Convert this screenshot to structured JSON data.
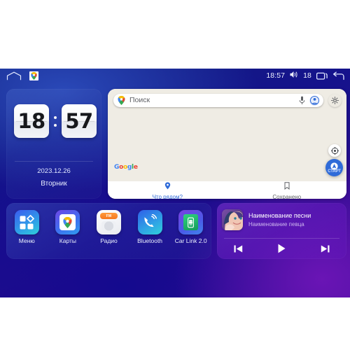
{
  "statusbar": {
    "home_icon": "home-outline-icon",
    "maps_icon": "google-maps-icon",
    "time": "18:57",
    "volume_icon": "volume-icon",
    "volume_level": "18",
    "recents_icon": "recents-square-icon",
    "back_icon": "back-arrow-icon"
  },
  "clock_widget": {
    "hours": "18",
    "minutes": "57",
    "date": "2023.12.26",
    "weekday": "Вторник"
  },
  "map_widget": {
    "search": {
      "placeholder": "Поиск",
      "pin_icon": "google-maps-pin-icon",
      "mic_icon": "microphone-icon",
      "avatar_icon": "account-avatar-icon"
    },
    "settings_icon": "gear-icon",
    "compass_icon": "compass-icon",
    "start_button_label": "СТАРТ",
    "start_button_icon": "navigation-arrow-icon",
    "brand": "Google",
    "tabs": [
      {
        "label": "Что рядом?",
        "icon": "location-pin-icon",
        "active": true
      },
      {
        "label": "Сохранено",
        "icon": "bookmark-icon",
        "active": false
      }
    ]
  },
  "apps": [
    {
      "label": "Меню",
      "icon": "grid-menu-icon"
    },
    {
      "label": "Карты",
      "icon": "google-maps-icon"
    },
    {
      "label": "Радио",
      "icon": "radio-icon",
      "badge": "FM"
    },
    {
      "label": "Bluetooth",
      "icon": "bluetooth-call-icon"
    },
    {
      "label": "Car Link 2.0",
      "icon": "car-link-icon"
    }
  ],
  "music_widget": {
    "album_art": "album-art-portrait",
    "title": "Наименование песни",
    "artist": "Наименование певца",
    "controls": [
      {
        "name": "previous",
        "icon": "skip-previous-icon"
      },
      {
        "name": "play",
        "icon": "play-icon"
      },
      {
        "name": "next",
        "icon": "skip-next-icon"
      }
    ]
  },
  "colors": {
    "accent_blue": "#2f6bd8",
    "bg_deep_blue": "#15128c",
    "bg_purple": "#4e0c9e",
    "map_surface": "#efece4",
    "radio_orange": "#f5781f"
  }
}
